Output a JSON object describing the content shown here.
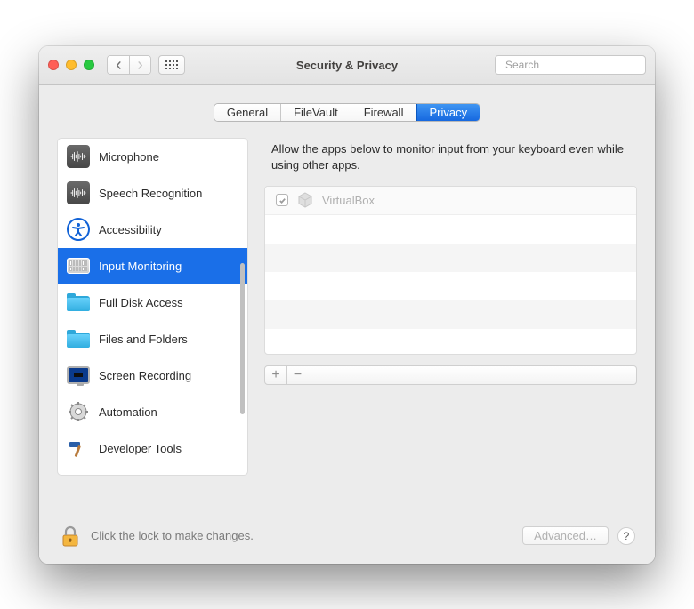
{
  "window": {
    "title": "Security & Privacy"
  },
  "search": {
    "placeholder": "Search"
  },
  "tabs": {
    "general": "General",
    "filevault": "FileVault",
    "firewall": "Firewall",
    "privacy": "Privacy"
  },
  "sidebar": {
    "items": [
      {
        "label": "Microphone",
        "icon": "waveform-icon",
        "selected": false
      },
      {
        "label": "Speech Recognition",
        "icon": "waveform-icon",
        "selected": false
      },
      {
        "label": "Accessibility",
        "icon": "accessibility-icon",
        "selected": false
      },
      {
        "label": "Input Monitoring",
        "icon": "keyboard-icon",
        "selected": true
      },
      {
        "label": "Full Disk Access",
        "icon": "folder-icon",
        "selected": false
      },
      {
        "label": "Files and Folders",
        "icon": "folder-icon",
        "selected": false
      },
      {
        "label": "Screen Recording",
        "icon": "screen-icon",
        "selected": false
      },
      {
        "label": "Automation",
        "icon": "gear-icon",
        "selected": false
      },
      {
        "label": "Developer Tools",
        "icon": "hammer-icon",
        "selected": false
      }
    ]
  },
  "pane": {
    "description": "Allow the apps below to monitor input from your keyboard even while using other apps.",
    "apps": [
      {
        "name": "VirtualBox",
        "checked": true,
        "enabled": false
      }
    ]
  },
  "footer": {
    "lock_text": "Click the lock to make changes.",
    "advanced_label": "Advanced…",
    "help_label": "?"
  }
}
